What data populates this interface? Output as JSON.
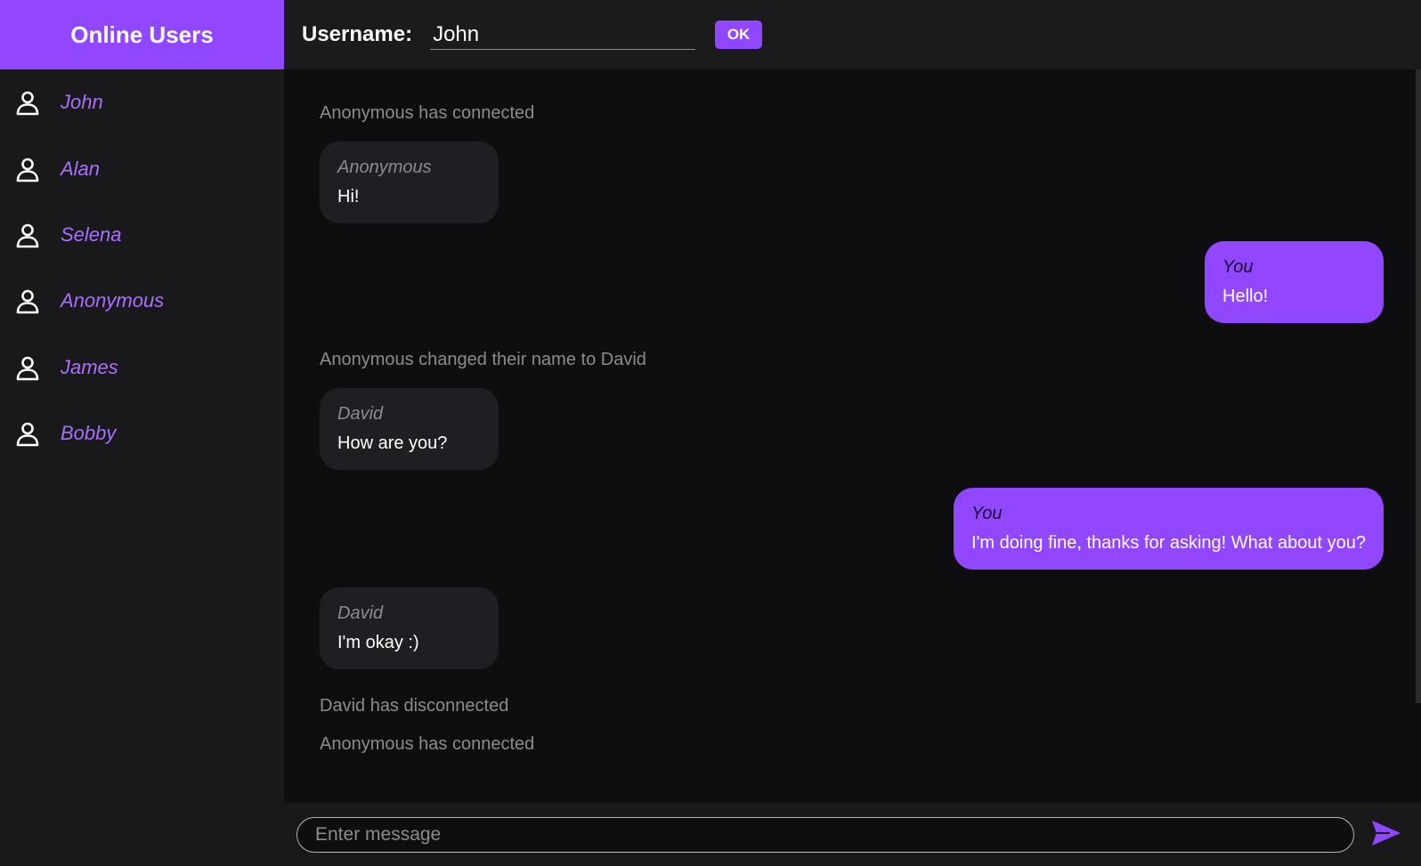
{
  "sidebar": {
    "title": "Online Users",
    "users": [
      {
        "name": "John",
        "icon": "user-icon"
      },
      {
        "name": "Alan",
        "icon": "user-icon"
      },
      {
        "name": "Selena",
        "icon": "user-icon"
      },
      {
        "name": "Anonymous",
        "icon": "user-icon"
      },
      {
        "name": "James",
        "icon": "user-icon"
      },
      {
        "name": "Bobby",
        "icon": "user-icon"
      }
    ]
  },
  "header": {
    "username_label": "Username:",
    "username_value": "John",
    "ok_label": "OK"
  },
  "messages": [
    {
      "type": "system",
      "text": "Anonymous has connected"
    },
    {
      "type": "in",
      "author": "Anonymous",
      "text": "Hi!"
    },
    {
      "type": "out",
      "author": "You",
      "text": "Hello!"
    },
    {
      "type": "system",
      "text": "Anonymous changed their name to David"
    },
    {
      "type": "in",
      "author": "David",
      "text": "How are you?"
    },
    {
      "type": "out",
      "author": "You",
      "text": "I'm doing fine, thanks for asking! What about you?"
    },
    {
      "type": "in",
      "author": "David",
      "text": "I'm okay :)"
    },
    {
      "type": "system",
      "text": "David has disconnected"
    },
    {
      "type": "system",
      "text": "Anonymous has connected"
    }
  ],
  "composer": {
    "placeholder": "Enter message",
    "send_icon": "send-icon"
  },
  "colors": {
    "accent": "#9147ff",
    "sidebar_bg": "#19191b",
    "chat_bg": "#0e0e10",
    "user_name": "#a970ff",
    "system_text": "#8b8b90"
  }
}
